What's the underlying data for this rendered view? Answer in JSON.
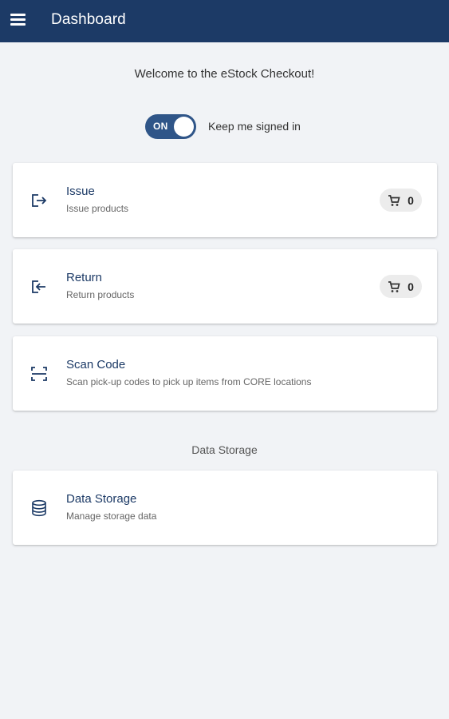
{
  "appbar": {
    "title": "Dashboard",
    "menu_icon": "hamburger-menu-icon"
  },
  "welcome": "Welcome to the eStock Checkout!",
  "toggle": {
    "state_text": "ON",
    "label": "Keep me signed in",
    "on": true
  },
  "cards": [
    {
      "title": "Issue",
      "subtitle": "Issue products",
      "icon": "issue-icon",
      "cart_count": "0"
    },
    {
      "title": "Return",
      "subtitle": "Return products",
      "icon": "return-icon",
      "cart_count": "0"
    },
    {
      "title": "Scan Code",
      "subtitle": "Scan pick-up codes to pick up items from CORE locations",
      "icon": "scan-icon"
    }
  ],
  "section": {
    "title": "Data Storage"
  },
  "storage_card": {
    "title": "Data Storage",
    "subtitle": "Manage storage data",
    "icon": "database-icon"
  },
  "colors": {
    "appbar": "#1c3a66",
    "accent": "#2f5588",
    "background": "#f1f3f6"
  }
}
